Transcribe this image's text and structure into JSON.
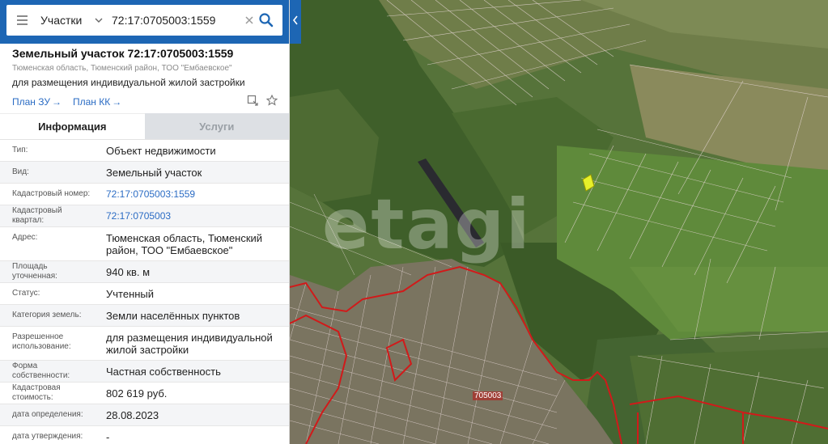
{
  "search": {
    "type_label": "Участки",
    "query": "72:17:0705003:1559"
  },
  "card": {
    "title": "Земельный участок 72:17:0705003:1559",
    "subtitle": "Тюменская область, Тюменский район, ТОО \"Ембаевское\"",
    "purpose": "для размещения индивидуальной жилой застройки",
    "plan_zu": "План ЗУ",
    "plan_kk": "План КК"
  },
  "tabs": {
    "info": "Информация",
    "services": "Услуги"
  },
  "rows": [
    {
      "label": "Тип:",
      "value": "Объект недвижимости"
    },
    {
      "label": "Вид:",
      "value": "Земельный участок"
    },
    {
      "label": "Кадастровый номер:",
      "value": "72:17:0705003:1559"
    },
    {
      "label": "Кадастровый квартал:",
      "value": "72:17:0705003"
    },
    {
      "label": "Адрес:",
      "value": "Тюменская область, Тюменский район, ТОО \"Ембаевское\""
    },
    {
      "label": "Площадь уточненная:",
      "value": "940 кв. м"
    },
    {
      "label": "Статус:",
      "value": "Учтенный"
    },
    {
      "label": "Категория земель:",
      "value": "Земли населённых пунктов"
    },
    {
      "label": "Разрешенное использование:",
      "value": "для размещения индивидуальной жилой застройки"
    },
    {
      "label": "Форма собственности:",
      "value": "Частная собственность"
    },
    {
      "label": "Кадастровая стоимость:",
      "value": "802 619 руб."
    },
    {
      "label": "дата определения:",
      "value": "28.08.2023"
    },
    {
      "label": "дата утверждения:",
      "value": "-"
    }
  ],
  "map": {
    "watermark": "etagi",
    "quarter_label": "705003"
  },
  "colors": {
    "brand": "#1d66b4",
    "link": "#2b6cc4",
    "boundary": "#d11a1a",
    "selected_parcel": "#e6f02a"
  },
  "icons": {
    "menu": "menu-icon",
    "chevron": "chevron-down-icon",
    "clear": "close-icon",
    "search": "search-icon",
    "collapse": "chevron-left-icon",
    "share": "share-icon",
    "favorite": "star-icon"
  }
}
